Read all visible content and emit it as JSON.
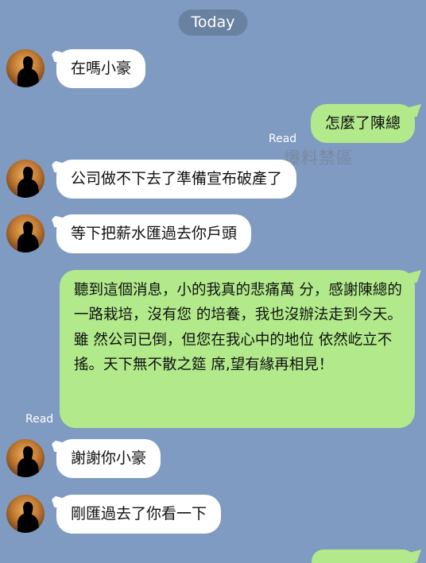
{
  "chat": {
    "date_label": "Today",
    "watermark": "爆料禁區",
    "messages": [
      {
        "direction": "in",
        "text": "在嗎小豪"
      },
      {
        "direction": "out",
        "text": "怎麼了陳總",
        "status": "Read"
      },
      {
        "direction": "in",
        "text": "公司做不下去了準備宣布破產了"
      },
      {
        "direction": "in",
        "text": "等下把薪水匯過去你戶頭"
      },
      {
        "direction": "out",
        "text": "聽到這個消息，小的我真的悲痛萬 分，感謝陳總的一路栽培，沒有您 的培養，我也沒辦法走到今天。雖 然公司已倒，但您在我心中的地位 依然屹立不搖。天下無不散之筵 席,望有緣再相見！",
        "status": "Read"
      },
      {
        "direction": "in",
        "text": "謝謝你小豪"
      },
      {
        "direction": "in",
        "text": "剛匯過去了你看一下"
      },
      {
        "direction": "out",
        "text": ""
      }
    ]
  },
  "colors": {
    "background": "#7f9bc1",
    "incoming_bubble": "#ffffff",
    "outgoing_bubble": "#b1e98b",
    "text": "#111111"
  },
  "icons": {
    "avatar": "silhouette-avatar-icon"
  }
}
